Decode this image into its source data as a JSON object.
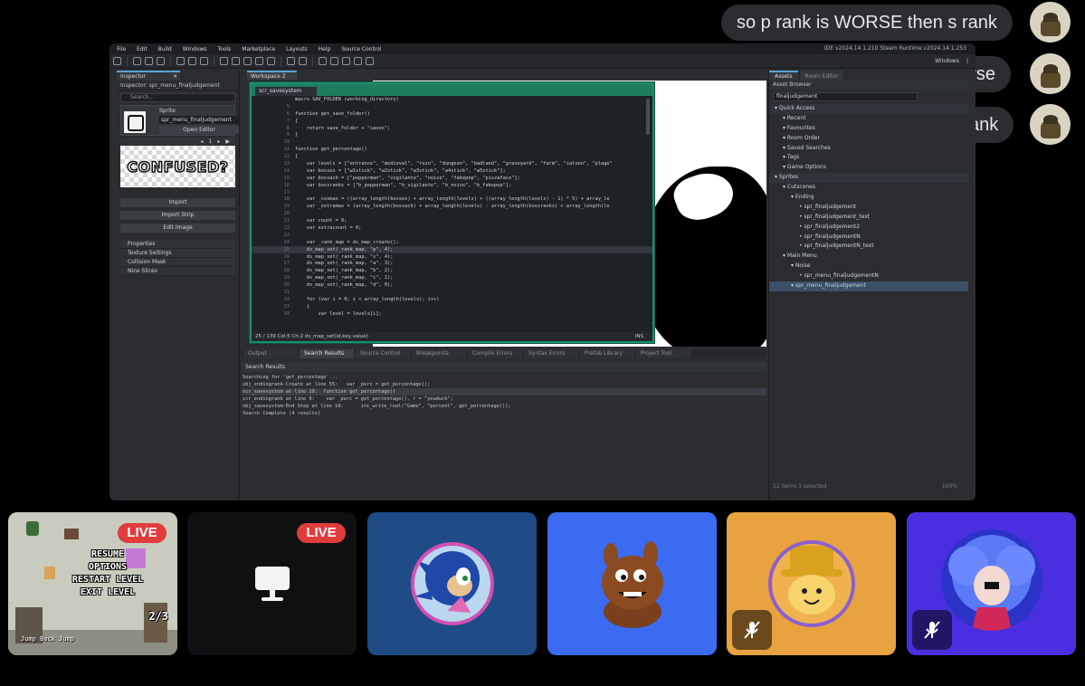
{
  "chat": {
    "messages": [
      {
        "text": "so p rank is WORSE then s rank"
      },
      {
        "text": "or not worse"
      },
      {
        "text": "the same as S rank"
      }
    ]
  },
  "ide": {
    "menu": [
      "File",
      "Edit",
      "Build",
      "Windows",
      "Tools",
      "Marketplace",
      "Layouts",
      "Help",
      "Source Control"
    ],
    "version": "IDE v2024.14.1.210 Steam  Runtime v2024.14.1.253",
    "toolbar_right": [
      "Windows",
      "|"
    ],
    "inspector": {
      "tab": "Inspector",
      "title": "Inspector: spr_menu_finaljudgement",
      "search_placeholder": "Search...",
      "sprite_label": "Sprite",
      "sprite_name": "spr_menu_finaljudgement",
      "open_editor": "Open Editor",
      "frame": "1",
      "preview_text": "CONFUSED?",
      "buttons": [
        "Import",
        "Import Strip",
        "Edit Image"
      ],
      "sections": [
        "Properties",
        "Texture Settings",
        "Collision Mask",
        "Nine Slices"
      ]
    },
    "workspace_tab": "Workspace 2",
    "code_tab": "scr_savesystem",
    "code_lines": [
      {
        "n": "",
        "t": "macro SAV_FOLDER (working_directory)"
      },
      {
        "n": "5",
        "t": ""
      },
      {
        "n": "6",
        "t": "function get_save_folder()"
      },
      {
        "n": "7",
        "t": "{"
      },
      {
        "n": "8",
        "t": "    return save_folder + \"saves\";"
      },
      {
        "n": "9",
        "t": "}"
      },
      {
        "n": "10",
        "t": ""
      },
      {
        "n": "11",
        "t": "function get_percentage()"
      },
      {
        "n": "12",
        "t": "{"
      },
      {
        "n": "13",
        "t": "    var levels = [\"entrance\", \"medieval\", \"ruin\", \"dungeon\", \"badland\", \"graveyard\", \"farm\", \"saloon\", \"plage\""
      },
      {
        "n": "14",
        "t": "    var bosses = [\"w1stick\", \"w2stick\", \"w3stick\", \"w4stick\", \"w5stick\"];"
      },
      {
        "n": "15",
        "t": "    var bossach = [\"pepperman\", \"vigilante\", \"noise\", \"fakepep\", \"pizzaface\"];"
      },
      {
        "n": "16",
        "t": "    var bossranks = [\"b_pepperman\", \"b_vigilante\", \"b_noise\", \"b_fakepep\"];"
      },
      {
        "n": "17",
        "t": ""
      },
      {
        "n": "18",
        "t": "    var _cosmax = ((array_length(bosses) + array_length(levels) + ((array_length(levels) - 1) * 5) + array_le"
      },
      {
        "n": "19",
        "t": "    var _extramax = (array_length(bossach) + array_length(levels) - array_length(bossranks) + array_length(le"
      },
      {
        "n": "20",
        "t": ""
      },
      {
        "n": "21",
        "t": "    var count = 0;"
      },
      {
        "n": "22",
        "t": "    var extracount = 0;"
      },
      {
        "n": "23",
        "t": ""
      },
      {
        "n": "24",
        "t": "    var _rank_map = ds_map_create();"
      },
      {
        "n": "25",
        "t": "    ds_map_set(_rank_map, \"p\", 4);"
      },
      {
        "n": "26",
        "t": "    ds_map_set(_rank_map, \"s\", 4);"
      },
      {
        "n": "27",
        "t": "    ds_map_set(_rank_map, \"a\", 3);"
      },
      {
        "n": "28",
        "t": "    ds_map_set(_rank_map, \"b\", 2);"
      },
      {
        "n": "29",
        "t": "    ds_map_set(_rank_map, \"c\", 1);"
      },
      {
        "n": "30",
        "t": "    ds_map_set(_rank_map, \"d\", 0);"
      },
      {
        "n": "31",
        "t": ""
      },
      {
        "n": "32",
        "t": "    for (var i = 0; i < array_length(levels); i++)"
      },
      {
        "n": "33",
        "t": "    {"
      },
      {
        "n": "34",
        "t": "        var level = levels[i];"
      }
    ],
    "code_status": "25 / 139 Col:5 Ch:2     ds_map_set(id,key,value)",
    "code_ins": "INS",
    "output_tabs": [
      "Output",
      "Search Results",
      "Source Control",
      "Breakpoints",
      "Compile Errors",
      "Syntax Errors",
      "Prefab Library",
      "Project Tool"
    ],
    "search_header": "Search Results",
    "search_results": [
      "Searching for 'get_percentage'...",
      "obj_endingrank-Create at line 55:   var _perc = get_percentage();",
      "scr_savesystem at line 10:  function get_percentage()",
      "scr_endingrank at line 9:    var _perc = get_percentage(), r = \"youduck\";",
      "obj_savesystem-End Step at line 18:      ini_write_real(\"Game\", \"percent\", get_percentage());",
      "Search Complete (4 results)"
    ],
    "assets": {
      "tabs": [
        "Assets",
        "Room Editor"
      ],
      "title": "Asset Browser",
      "search_value": "finaljudgement",
      "tree": [
        {
          "label": "Quick Access",
          "indent": 0,
          "kind": "section"
        },
        {
          "label": "Recent",
          "indent": 1
        },
        {
          "label": "Favourites",
          "indent": 1
        },
        {
          "label": "Room Order",
          "indent": 1
        },
        {
          "label": "Saved Searches",
          "indent": 1
        },
        {
          "label": "Tags",
          "indent": 1
        },
        {
          "label": "Game Options",
          "indent": 1
        },
        {
          "label": "Sprites",
          "indent": 0,
          "kind": "section"
        },
        {
          "label": "Cutscenes",
          "indent": 1
        },
        {
          "label": "Ending",
          "indent": 2
        },
        {
          "label": "spr_finaljudgement",
          "indent": 3
        },
        {
          "label": "spr_finaljudgement_text",
          "indent": 3
        },
        {
          "label": "spr_finaljudgement2",
          "indent": 3
        },
        {
          "label": "spr_finaljudgementN",
          "indent": 3
        },
        {
          "label": "spr_finaljudgementN_text",
          "indent": 3
        },
        {
          "label": "Main Menu",
          "indent": 1
        },
        {
          "label": "Noise",
          "indent": 2
        },
        {
          "label": "spr_menu_finaljudgementN",
          "indent": 3
        },
        {
          "label": "spr_menu_finaljudgement",
          "indent": 2,
          "kind": "sel"
        }
      ],
      "footer": "12 items    1 selected",
      "zoom": "100%"
    }
  },
  "tiles": {
    "live_label": "LIVE",
    "game_menu": [
      "RESUME",
      "OPTIONS",
      "RESTART LEVEL",
      "EXIT LEVEL"
    ],
    "game_hint": "Jump    Back    Jump",
    "game_counter": "2/3"
  },
  "colors": {
    "live": "#e03c3c",
    "tile_blue_dark": "#1f4b86",
    "tile_blue": "#3b6bf0",
    "tile_orange": "#e8a240",
    "tile_purple": "#4a2fe0"
  }
}
